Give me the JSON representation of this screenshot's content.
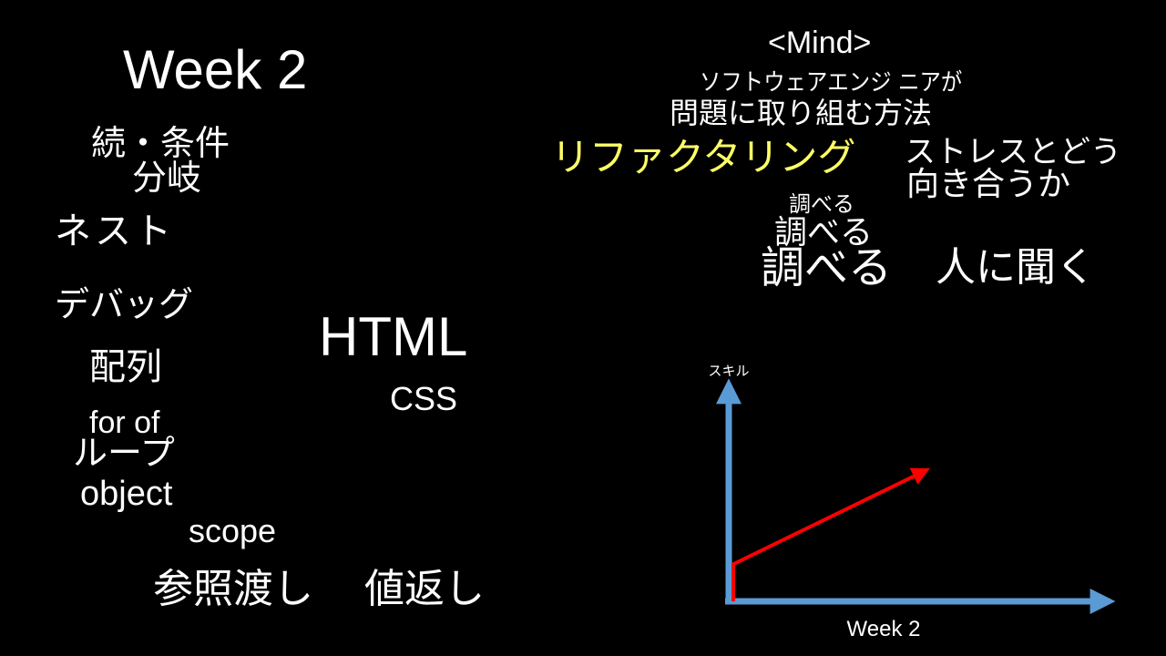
{
  "slide": {
    "title": "Week 2",
    "topics": {
      "condition_line1": "続・条件",
      "condition_line2": "分岐",
      "nest": "ネスト",
      "debug": "デバッグ",
      "array": "配列",
      "for_of": "for of",
      "loop": "ループ",
      "object": "object",
      "scope": "scope",
      "pass_by_reference": "参照渡し",
      "return_value": "値返し",
      "html": "HTML",
      "css": "CSS"
    },
    "mind": {
      "heading": "<Mind>",
      "engineer_line1": "ソフトウェアエンジ ニアが",
      "engineer_line2": "問題に取り組む方法",
      "refactoring": "リファクタリング",
      "stress_line1": "ストレスとどう",
      "stress_line2": "向き合うか",
      "look_up_small": "調べる",
      "look_up_medium": "調べる",
      "look_up_large": "調べる",
      "ask_people": "人に聞く"
    },
    "colors": {
      "background": "#000000",
      "text": "#ffffff",
      "highlight": "#ffff66",
      "axis": "#5b9bd5",
      "trend": "#ff0000"
    }
  },
  "chart_data": {
    "type": "line",
    "title": "",
    "xlabel": "Week 2",
    "ylabel": "スキル",
    "series": [
      {
        "x": [
          0,
          0,
          1
        ],
        "y": [
          0,
          0.17,
          0.59
        ]
      }
    ],
    "xlim": [
      0,
      1
    ],
    "ylim": [
      0,
      1
    ],
    "grid": false,
    "legend": "none"
  }
}
